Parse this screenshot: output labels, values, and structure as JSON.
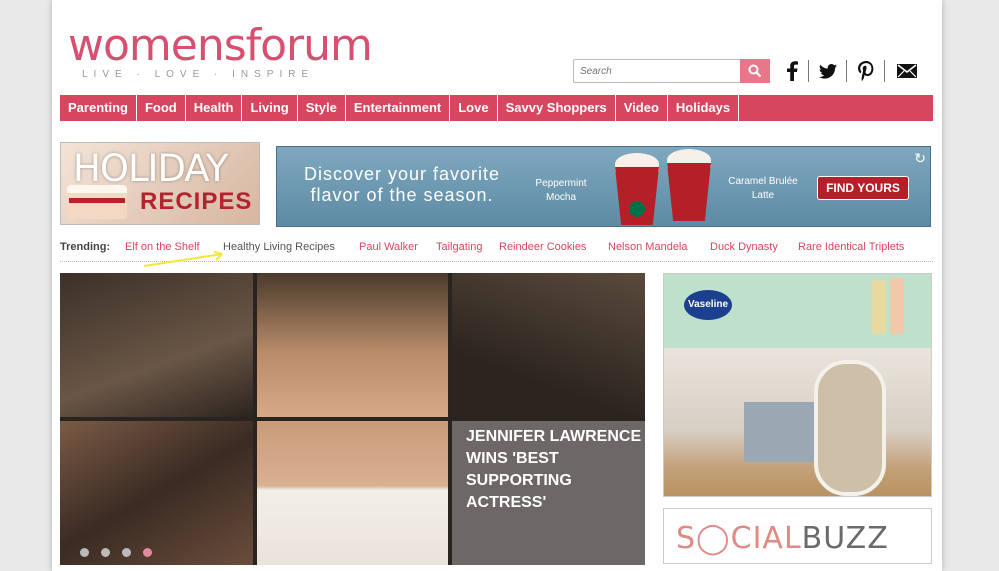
{
  "logo": {
    "name": "womensforum",
    "tagline": "LIVE · LOVE · INSPIRE"
  },
  "search": {
    "placeholder": "Search"
  },
  "social": [
    "facebook-icon",
    "twitter-icon",
    "pinterest-icon",
    "email-icon"
  ],
  "nav": [
    "Parenting",
    "Food",
    "Health",
    "Living",
    "Style",
    "Entertainment",
    "Love",
    "Savvy Shoppers",
    "Video",
    "Holidays"
  ],
  "holiday_banner": {
    "line1": "HOLIDAY",
    "line2": "RECIPES"
  },
  "ad": {
    "headline": "Discover your favorite flavor of the season.",
    "flavor1": "Peppermint Mocha",
    "flavor2": "Caramel Brulée Latte",
    "cta": "FIND YOURS"
  },
  "trending": {
    "label": "Trending:",
    "items": [
      "Elf on the Shelf",
      "Healthy Living Recipes",
      "Paul Walker",
      "Tailgating",
      "Reindeer Cookies",
      "Nelson Mandela",
      "Duck Dynasty",
      "Rare Identical Triplets"
    ]
  },
  "hero": {
    "title": "JENNIFER LAWRENCE WINS 'BEST SUPPORTING ACTRESS'"
  },
  "sidebar": {
    "ad_brand": "Vaseline",
    "buzz_part1": "S",
    "buzz_part2": "CIAL",
    "buzz_part3": "BUZZ"
  },
  "colors": {
    "brand": "#d7465f",
    "accent": "#e8778a"
  }
}
